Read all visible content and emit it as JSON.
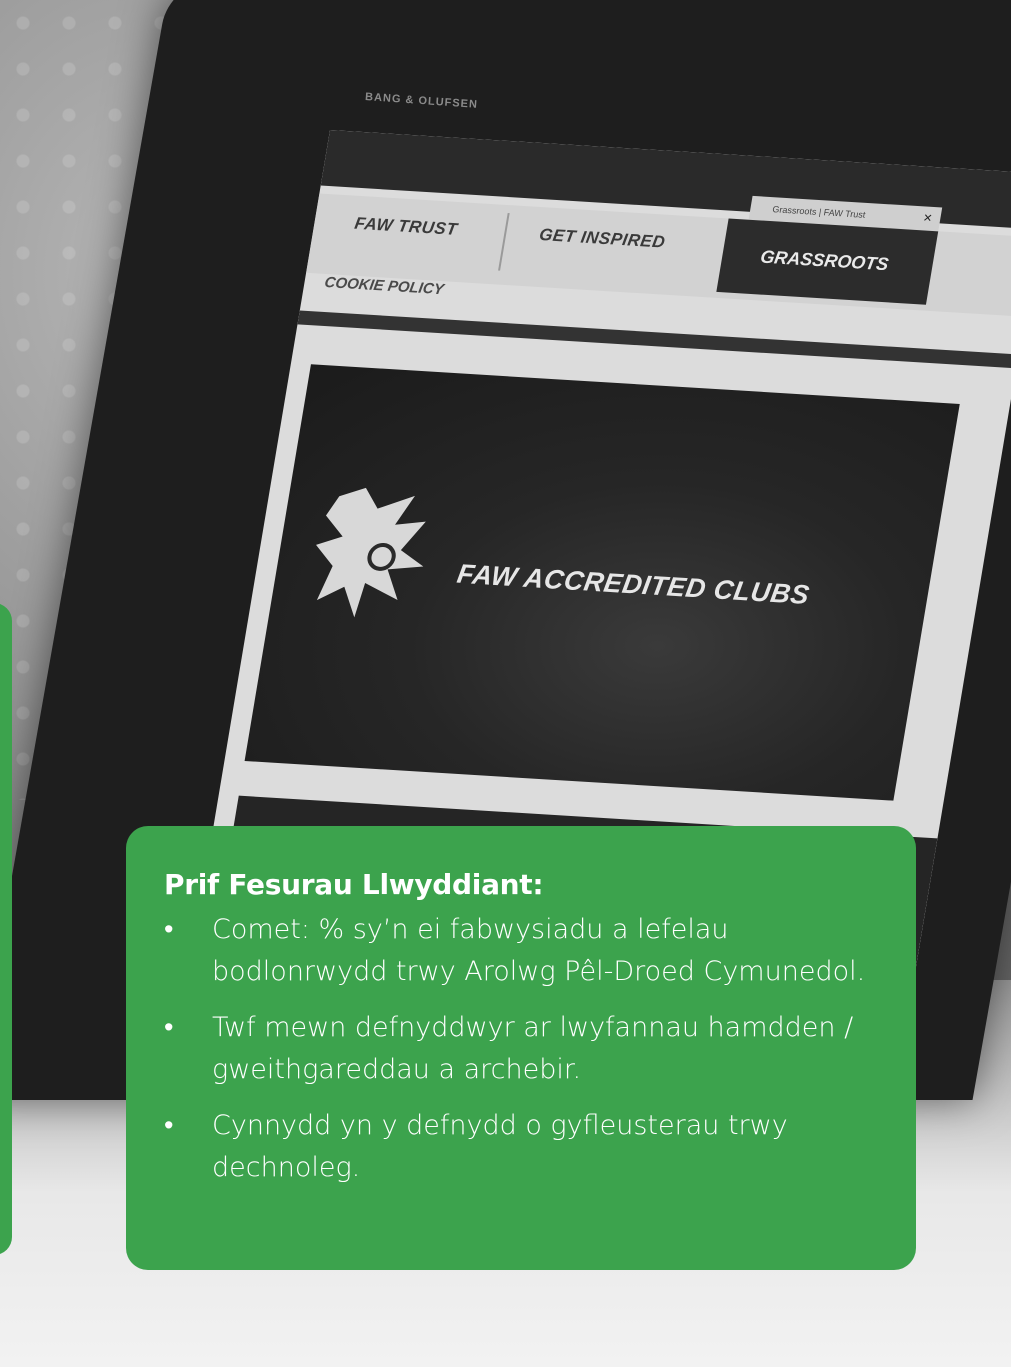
{
  "background": {
    "laptop_brand": "BANG & OLUFSEN",
    "browser_tab_title": "Grassroots | FAW Trust",
    "nav": {
      "item1": "FAW TRUST",
      "item2": "GET INSPIRED",
      "item3": "GRASSROOTS",
      "sub_item": "COOKIE POLICY"
    },
    "hero_title": "FAW ACCREDITED CLUBS"
  },
  "card": {
    "heading": "Prif Fesurau Llwyddiant:",
    "bullet_symbol": "•",
    "items": [
      "Comet: % sy’n ei fabwysiadu a lefelau bodlonrwydd trwy Arolwg Pêl-Droed Cymunedol.",
      "Twf mewn defnyddwyr ar lwyfannau hamdden / gweithgareddau a archebir.",
      "Cynnydd yn y defnydd o gyfleusterau trwy dechnoleg."
    ]
  },
  "colors": {
    "accent_green": "#3ca34d",
    "card_text": "#ffffff"
  }
}
